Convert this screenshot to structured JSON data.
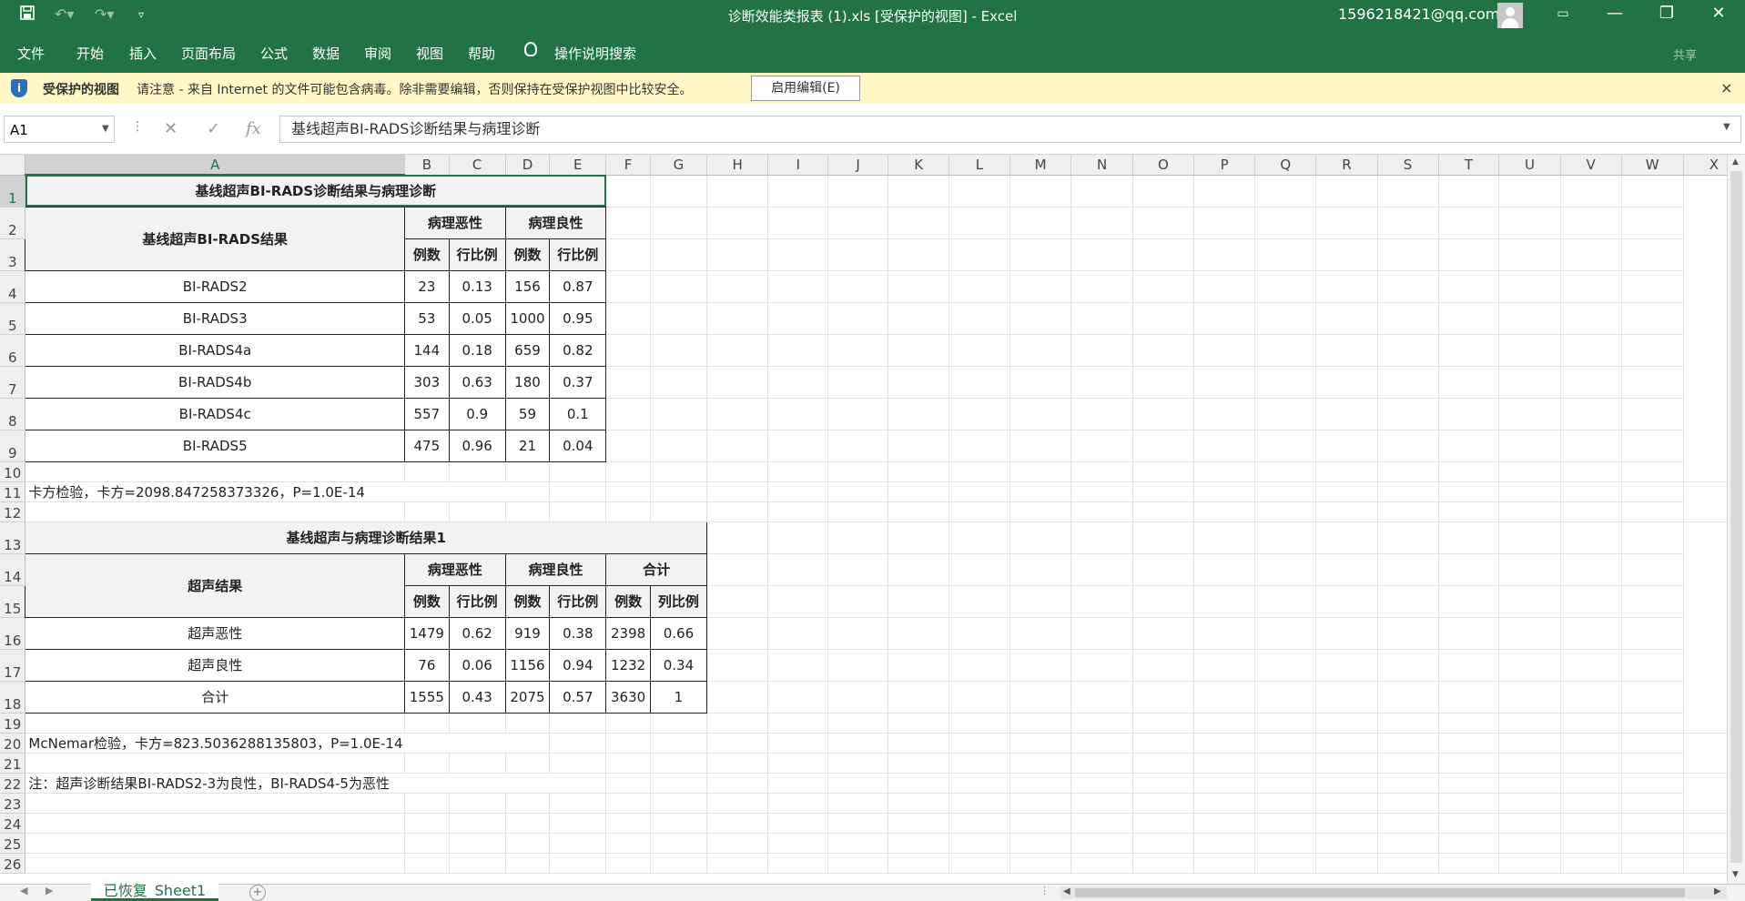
{
  "window": {
    "title": "诊断效能类报表 (1).xls  [受保护的视图]  -  Excel",
    "account": "1596218421@qq.com",
    "qat": {
      "save_icon": "save-icon",
      "undo_icon": "undo-icon",
      "redo_icon": "redo-icon",
      "customize_icon": "customize-qat-icon"
    },
    "controls": {
      "ribbon_display": "▭",
      "minimize": "—",
      "restore": "❐",
      "close": "✕"
    }
  },
  "menu": {
    "items": [
      "文件",
      "开始",
      "插入",
      "页面布局",
      "公式",
      "数据",
      "审阅",
      "视图",
      "帮助"
    ],
    "tell_me": "操作说明搜索",
    "share": "共享"
  },
  "protected_bar": {
    "title": "受保护的视图",
    "message": "请注意 - 来自 Internet 的文件可能包含病毒。除非需要编辑，否则保持在受保护视图中比较安全。",
    "enable_button": "启用编辑(E)",
    "close": "×"
  },
  "formula_bar": {
    "name_box": "A1",
    "content": "基线超声BI-RADS诊断结果与病理诊断",
    "cancel": "✕",
    "enter": "✓",
    "fx": "fx"
  },
  "columns": [
    "A",
    "B",
    "C",
    "D",
    "E",
    "F",
    "G",
    "H",
    "I",
    "J",
    "K",
    "L",
    "M",
    "N",
    "O",
    "P",
    "Q",
    "R",
    "S",
    "T",
    "U",
    "V",
    "W",
    "X"
  ],
  "rows": [
    "1",
    "2",
    "3",
    "4",
    "5",
    "6",
    "7",
    "8",
    "9",
    "10",
    "11",
    "12",
    "13",
    "14",
    "15",
    "16",
    "17",
    "18",
    "19",
    "20",
    "21",
    "22",
    "23",
    "24",
    "25",
    "26"
  ],
  "table1": {
    "title": "基线超声BI-RADS诊断结果与病理诊断",
    "row_header": "基线超声BI-RADS结果",
    "groups": [
      "病理恶性",
      "病理良性"
    ],
    "subheaders": [
      "例数",
      "行比例",
      "例数",
      "行比例"
    ],
    "rows": [
      [
        "BI-RADS2",
        "23",
        "0.13",
        "156",
        "0.87"
      ],
      [
        "BI-RADS3",
        "53",
        "0.05",
        "1000",
        "0.95"
      ],
      [
        "BI-RADS4a",
        "144",
        "0.18",
        "659",
        "0.82"
      ],
      [
        "BI-RADS4b",
        "303",
        "0.63",
        "180",
        "0.37"
      ],
      [
        "BI-RADS4c",
        "557",
        "0.9",
        "59",
        "0.1"
      ],
      [
        "BI-RADS5",
        "475",
        "0.96",
        "21",
        "0.04"
      ]
    ],
    "test_note": "卡方检验，卡方=2098.847258373326，P=1.0E-14"
  },
  "table2": {
    "title": "基线超声与病理诊断结果1",
    "row_header": "超声结果",
    "groups": [
      "病理恶性",
      "病理良性",
      "合计"
    ],
    "subheaders": [
      "例数",
      "行比例",
      "例数",
      "行比例",
      "例数",
      "列比例"
    ],
    "rows": [
      [
        "超声恶性",
        "1479",
        "0.62",
        "919",
        "0.38",
        "2398",
        "0.66"
      ],
      [
        "超声良性",
        "76",
        "0.06",
        "1156",
        "0.94",
        "1232",
        "0.34"
      ],
      [
        "合计",
        "1555",
        "0.43",
        "2075",
        "0.57",
        "3630",
        "1"
      ]
    ],
    "test_note": "McNemar检验，卡方=823.5036288135803，P=1.0E-14"
  },
  "footnote": "注：超声诊断结果BI-RADS2-3为良性，BI-RADS4-5为恶性",
  "sheet_tab": "已恢复_Sheet1"
}
